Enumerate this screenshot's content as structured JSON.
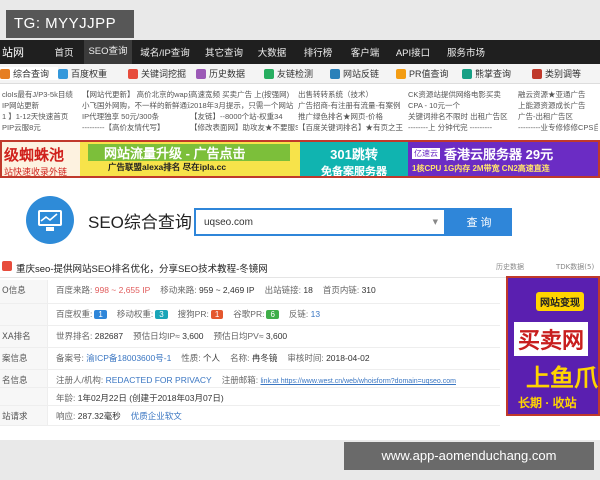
{
  "watermark_top": "TG: MYYJJPP",
  "watermark_bottom": "www.app-aomenduchang.com",
  "topnav": {
    "logo": "站网",
    "items": [
      "首页",
      "SEO查询",
      "域名/IP查询",
      "其它查询",
      "大数据",
      "排行榜",
      "客户端",
      "API接口",
      "服务市场"
    ],
    "active_index": 1
  },
  "tabs": [
    {
      "label": "综合查询",
      "icon_color": "#e67e22"
    },
    {
      "label": "百度权重",
      "icon_color": "#3498db"
    },
    {
      "label": "关键词挖掘",
      "icon_color": "#e74c3c"
    },
    {
      "label": "历史数据",
      "icon_color": "#9b59b6"
    },
    {
      "label": "友链检测",
      "icon_color": "#27ae60"
    },
    {
      "label": "网站反链",
      "icon_color": "#2980b9"
    },
    {
      "label": "PR值查询",
      "icon_color": "#f39c12"
    },
    {
      "label": "熊掌查询",
      "icon_color": "#16a085"
    },
    {
      "label": "类别调等",
      "icon_color": "#c0392b"
    }
  ],
  "link_rows": [
    [
      "cloIs最有J/P3-5k目绩",
      "【网站代更新】 高价北京的wap量",
      "高速宽频 买卖广告 上(按强网)",
      "出售转转系统（技术）",
      "CK资源站提供网络电影买卖",
      "融云资源★亚通广告"
    ],
    [
      "IP网站更新",
      "小飞国外网购，不一样的新鲜通道",
      "2018年3月提示，只需一个网站",
      "广告招商-有注册有流量-有案例",
      "CPA - 10元一个",
      "上能源资源成长广告"
    ],
    [
      "1 】1-12天快速首页",
      "IP代理独享 50元/300条",
      "【友链】--8000个站-权重34",
      "推广绿色排名★网页-价格",
      "关键词排名不限时 出租广告区",
      "广告-出租广告区"
    ],
    [
      "PIP云服8元",
      "---------【高价友情代写】",
      "【修改表面网】助攻友★不要服SEO",
      "【百度关键词排名】★有页之王",
      "--------上 分钟代完 ---------",
      "---------业专修修修CPS自营"
    ]
  ],
  "banner": {
    "ad1": {
      "line1": "级蜘蛛池",
      "line2": "站快速收录外链"
    },
    "ad2": {
      "line1": "网站流量升级 - 广告点击",
      "line2": "广告联盟alexa排名 尽在ipla.cc"
    },
    "ad3": {
      "line1": "301跳转",
      "line2": "免备案服务器"
    },
    "ad4": {
      "brand": "亿速云",
      "line1": "香港云服务器 29元",
      "line2": "1核CPU 1G内存 2M带宽 CN2高速直连"
    }
  },
  "search": {
    "title": "SEO综合查询",
    "value": "uqseo.com",
    "button": "查 询"
  },
  "result": {
    "title": "重庆seo-提供网站SEO排名优化，分享SEO技术教程-冬镜网",
    "history": "历史数据",
    "tdk": "TDK数据(5)"
  },
  "info_rows": [
    {
      "label": "O信息",
      "items": [
        {
          "k": "百度来路:",
          "v": "998 ~ 2,655 IP",
          "c": "red"
        },
        {
          "k": "移动来路:",
          "v": "959 ~ 2,469 IP",
          "c": ""
        },
        {
          "k": "出站链接:",
          "v": "18",
          "c": ""
        },
        {
          "k": "首页内链:",
          "v": "310",
          "c": ""
        }
      ]
    },
    {
      "label": "",
      "items": [
        {
          "k": "百度权重:",
          "v": "1",
          "c": "badge-blue"
        },
        {
          "k": "移动权重:",
          "v": "3",
          "c": "badge-teal"
        },
        {
          "k": "搜狗PR:",
          "v": "1",
          "c": "badge-red"
        },
        {
          "k": "谷歌PR:",
          "v": "6",
          "c": "badge-green"
        },
        {
          "k": "反链:",
          "v": "13",
          "c": ""
        }
      ]
    },
    {
      "label": "XA排名",
      "items": [
        {
          "k": "世界排名:",
          "v": "282687",
          "c": ""
        },
        {
          "k": "预估日均IP≈",
          "v": "3,600",
          "c": ""
        },
        {
          "k": "预估日均PV≈",
          "v": "3,600",
          "c": ""
        }
      ]
    },
    {
      "label": "案信息",
      "items": [
        {
          "k": "备案号:",
          "v": "渝ICP备18003600号-1",
          "c": "blue"
        },
        {
          "k": "性质:",
          "v": "个人",
          "c": ""
        },
        {
          "k": "名称:",
          "v": "冉冬镜",
          "c": ""
        },
        {
          "k": "审核时间:",
          "v": "2018-04-02",
          "c": ""
        }
      ]
    },
    {
      "label": "名信息",
      "items": [
        {
          "k": "注册人/机构:",
          "v": "REDACTED FOR PRIVACY",
          "c": "blue"
        },
        {
          "k": "注册邮箱:",
          "v": "link:at https://www.west.cn/web/whoisform?domain=uqseo.com",
          "c": "link"
        }
      ]
    },
    {
      "label": "",
      "items": [
        {
          "k": "年龄:",
          "v": "1年02月22日 (创建于2018年03月07日)",
          "c": ""
        }
      ]
    },
    {
      "label": "站请求",
      "items": [
        {
          "k": "响应:",
          "v": "287.32毫秒",
          "c": ""
        },
        {
          "k": "",
          "v": "优质企业软文",
          "c": "blue"
        }
      ]
    }
  ],
  "sidead": {
    "t1": "网站变现",
    "t2": "买卖网",
    "t3": "上鱼爪",
    "t4": "长期 · 收站"
  }
}
